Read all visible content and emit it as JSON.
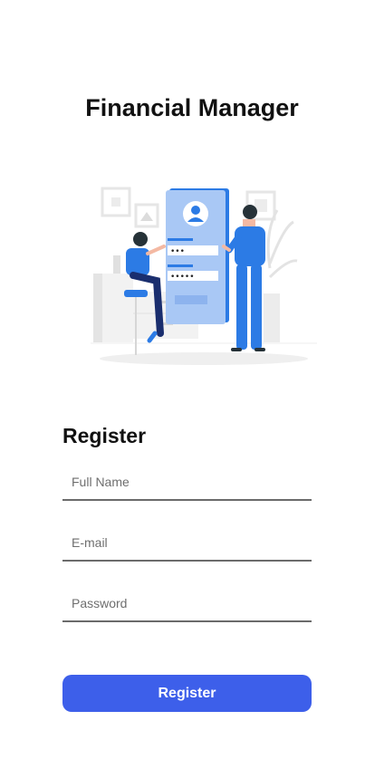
{
  "app": {
    "title": "Financial Manager"
  },
  "illustration": {
    "icon": "login-illustration",
    "accent_color": "#2c7be5",
    "masked_password": "•••",
    "masked_password_2": "•••••"
  },
  "form": {
    "title": "Register",
    "fields": {
      "full_name": {
        "placeholder": "Full Name",
        "value": ""
      },
      "email": {
        "placeholder": "E-mail",
        "value": ""
      },
      "password": {
        "placeholder": "Password",
        "value": ""
      }
    },
    "submit_label": "Register",
    "submit_color": "#3d5fea"
  }
}
